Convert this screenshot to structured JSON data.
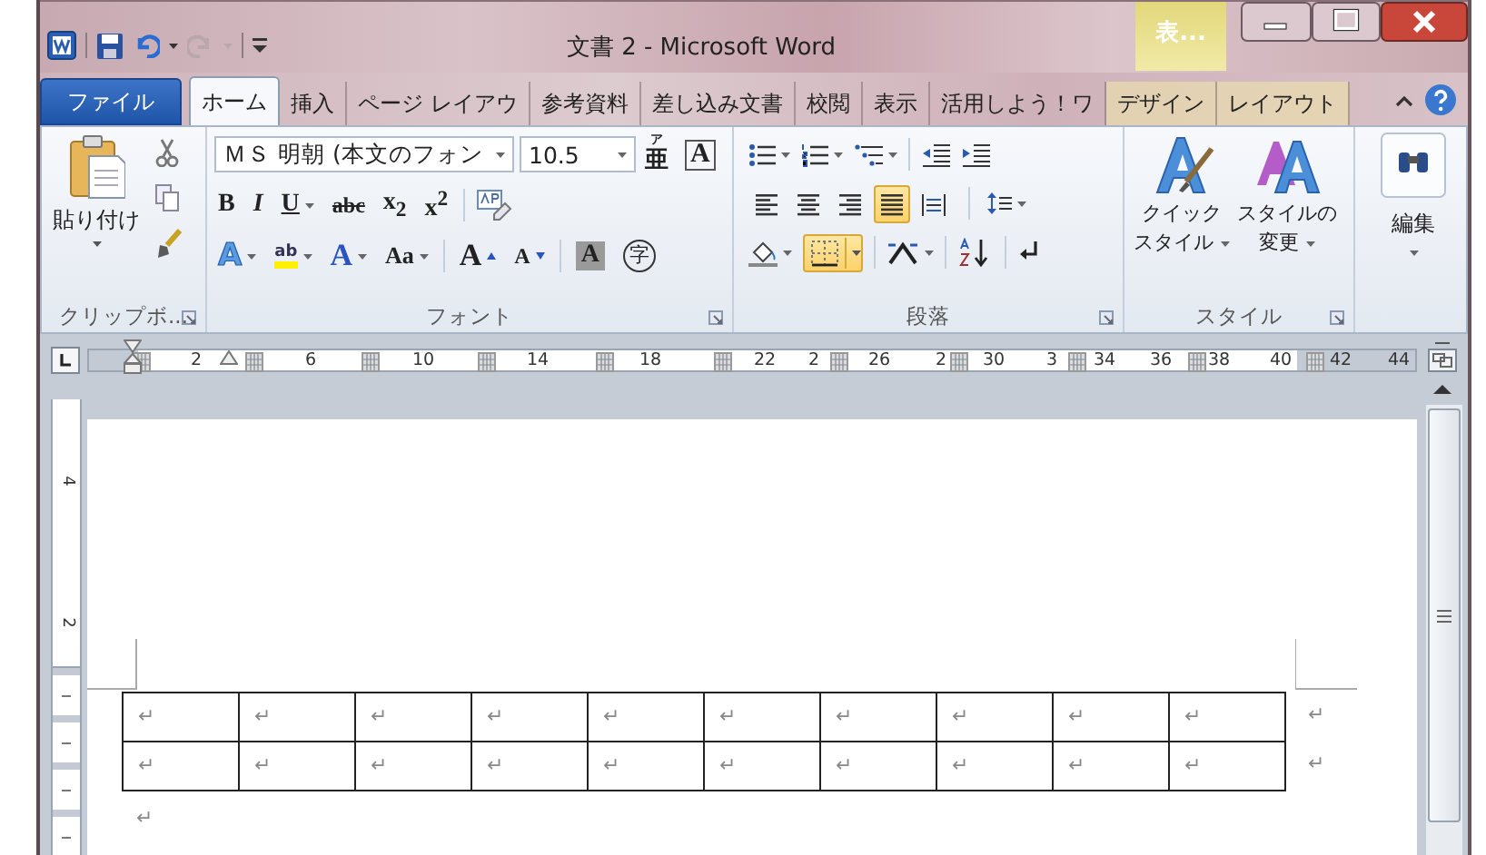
{
  "window": {
    "title": "文書 2 - Microsoft Word",
    "contextual_group": "表...",
    "quick_access": [
      {
        "kind": "save",
        "disabled": false
      },
      {
        "kind": "undo",
        "disabled": false
      },
      {
        "kind": "redo",
        "disabled": true
      }
    ]
  },
  "tabs": [
    {
      "label": "ファイル",
      "kind": "file",
      "selected": false
    },
    {
      "label": "ホーム",
      "kind": "normal",
      "selected": true
    },
    {
      "label": "挿入",
      "kind": "normal",
      "selected": false
    },
    {
      "label": "ページ レイアウ",
      "kind": "normal",
      "selected": false
    },
    {
      "label": "参考資料",
      "kind": "normal",
      "selected": false
    },
    {
      "label": "差し込み文書",
      "kind": "normal",
      "selected": false
    },
    {
      "label": "校閲",
      "kind": "normal",
      "selected": false
    },
    {
      "label": "表示",
      "kind": "normal",
      "selected": false
    },
    {
      "label": "活用しよう！ワ",
      "kind": "normal",
      "selected": false
    },
    {
      "label": "デザイン",
      "kind": "contextual",
      "selected": false
    },
    {
      "label": "レイアウト",
      "kind": "contextual",
      "selected": false
    }
  ],
  "ribbon": {
    "clipboard": {
      "paste": "貼り付け",
      "label": "クリップボ..."
    },
    "font": {
      "name": "ＭＳ 明朝 (本文のフォン",
      "size": "10.5",
      "label": "フォント",
      "row1_buttons": [
        {
          "kind": "ruby",
          "text": "亜",
          "ruby": "ア"
        },
        {
          "kind": "border",
          "text": "A"
        }
      ],
      "format_buttons": [
        {
          "kind": "bold",
          "text": "B",
          "dropdown": false
        },
        {
          "kind": "italic",
          "text": "I",
          "dropdown": false
        },
        {
          "kind": "underline",
          "text": "U",
          "dropdown": true
        },
        {
          "kind": "strike",
          "text": "abc",
          "dropdown": false
        },
        {
          "kind": "sub",
          "text": "x$_{2}$",
          "dropdown": false
        },
        {
          "kind": "sup",
          "text": "x$^{2}$",
          "dropdown": false
        }
      ],
      "effect_buttons": [
        {
          "kind": "effect",
          "text": "A",
          "dropdown": true
        },
        {
          "kind": "highlight",
          "text": "ab",
          "dropdown": true
        },
        {
          "kind": "color",
          "text": "A",
          "dropdown": true
        },
        {
          "kind": "case",
          "text": "Aa",
          "dropdown": true
        },
        {
          "kind": "grow",
          "text": "A",
          "dropdown": false
        },
        {
          "kind": "shrink",
          "text": "A",
          "dropdown": false
        },
        {
          "kind": "shade",
          "text": "A",
          "dropdown": false
        },
        {
          "kind": "enclose",
          "text": "字",
          "dropdown": false
        }
      ]
    },
    "paragraph": {
      "label": "段落",
      "borders_on": true,
      "alignment": [
        {
          "kind": "left",
          "selected": false
        },
        {
          "kind": "center",
          "selected": false
        },
        {
          "kind": "right",
          "selected": false
        },
        {
          "kind": "justify",
          "selected": true
        },
        {
          "kind": "distributed",
          "selected": false
        }
      ]
    },
    "styles": {
      "label": "スタイル",
      "quick_style": [
        "クイック",
        "スタイル"
      ],
      "change_styles": [
        "スタイルの",
        "変更"
      ]
    },
    "editing": {
      "label": "編集"
    }
  },
  "ruler": {
    "numbers": [
      "2",
      "6",
      "10",
      "14",
      "18",
      "22",
      "2",
      "26",
      "2",
      "30",
      "3",
      "34",
      "36",
      "38",
      "40",
      "42",
      "44"
    ]
  },
  "vertical_ruler": {
    "numbers": [
      "4",
      "2"
    ]
  },
  "document": {
    "table": {
      "rows": [
        [
          "↵",
          "↵",
          "↵",
          "↵",
          "↵",
          "↵",
          "↵",
          "↵",
          "↵",
          "↵"
        ],
        [
          "↵",
          "↵",
          "↵",
          "↵",
          "↵",
          "↵",
          "↵",
          "↵",
          "↵",
          "↵"
        ]
      ],
      "row_end_marks": [
        "↵",
        "↵"
      ]
    },
    "paragraph_mark": "↵"
  }
}
